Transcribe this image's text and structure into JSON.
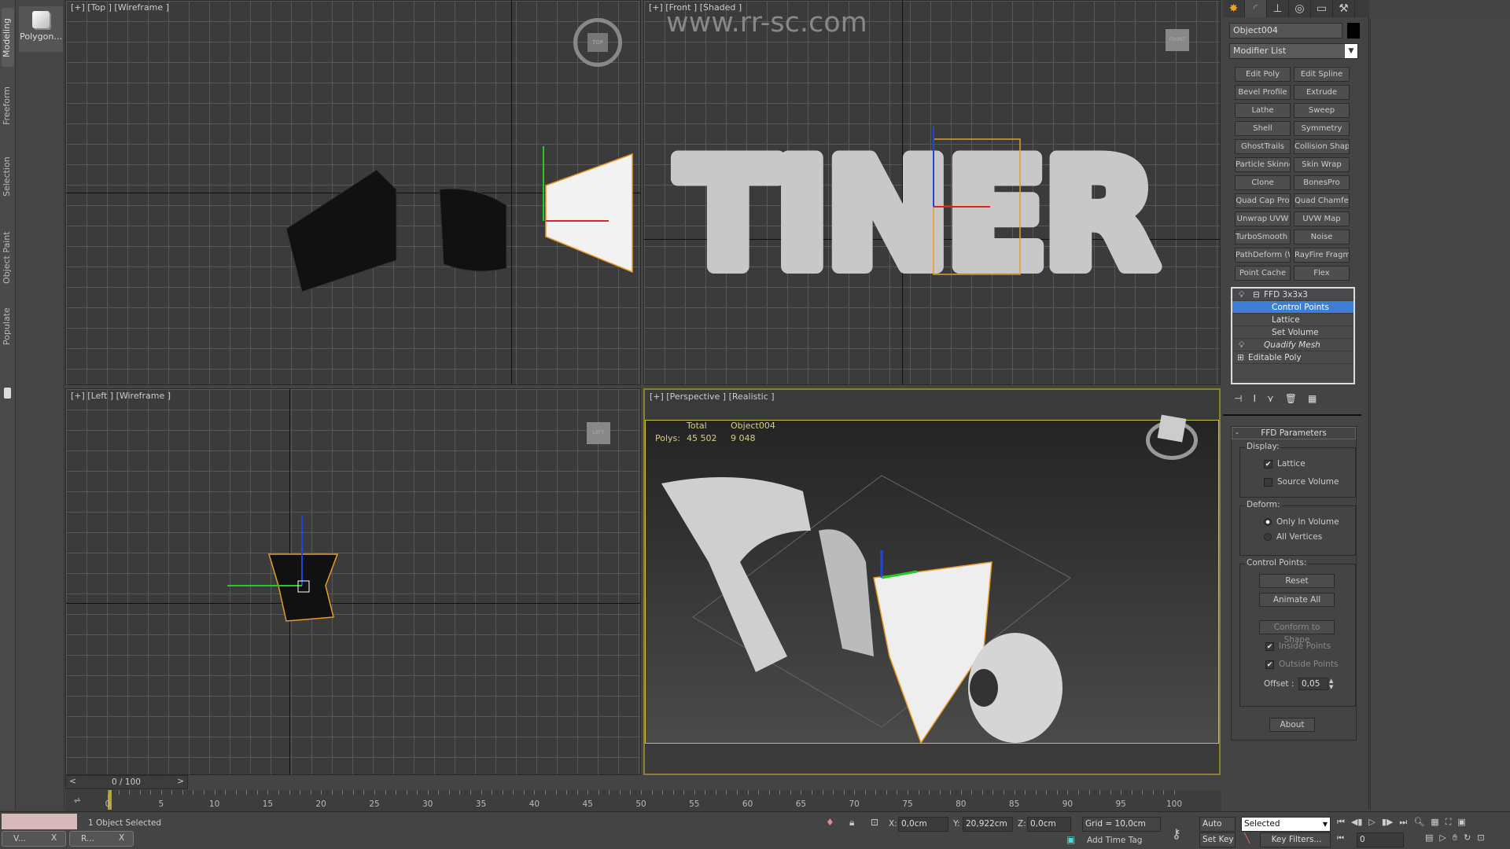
{
  "ribbon": {
    "tabs": [
      "Modeling",
      "Freeform",
      "Selection",
      "Object Paint",
      "Populate"
    ],
    "active_tab": "Modeling",
    "panel_button": "Polygon..."
  },
  "viewports": {
    "top": {
      "label": "[+] [Top ] [Wireframe ]",
      "gizmo": "TOP"
    },
    "front": {
      "label": "[+] [Front ] [Shaded ]",
      "gizmo": "FRONT",
      "scene_text": "TINER"
    },
    "left": {
      "label": "[+] [Left ] [Wireframe ]",
      "gizmo": "LEFT"
    },
    "perspective": {
      "label": "[+] [Perspective ] [Realistic ]",
      "stats": {
        "col_total": "Total",
        "col_object": "Object004",
        "row_label": "Polys:",
        "total": "45 502",
        "object": "9 048"
      }
    }
  },
  "watermark": "www.rr-sc.com",
  "command_panel": {
    "tabs": [
      "create-icon",
      "modify-icon",
      "hierarchy-icon",
      "motion-icon",
      "display-icon",
      "utilities-icon"
    ],
    "active_tab": "modify-icon",
    "object_name": "Object004",
    "object_color": "#000000",
    "modifier_list": "Modifier List",
    "modifier_buttons": [
      [
        "Edit Poly",
        "Edit Spline"
      ],
      [
        "Bevel Profile",
        "Extrude"
      ],
      [
        "Lathe",
        "Sweep"
      ],
      [
        "Shell",
        "Symmetry"
      ],
      [
        "GhostTrails",
        "Collision Shape"
      ],
      [
        "Particle Skinner",
        "Skin Wrap"
      ],
      [
        "Clone",
        "BonesPro"
      ],
      [
        "Quad Cap Pro",
        "Quad Chamfer"
      ],
      [
        "Unwrap UVW",
        "UVW Map"
      ],
      [
        "TurboSmooth Pr",
        "Noise"
      ],
      [
        "PathDeform (WS",
        "RayFire Fragmen"
      ],
      [
        "Point Cache",
        "Flex"
      ]
    ],
    "stack": {
      "ffd": "FFD 3x3x3",
      "sub": [
        "Control Points",
        "Lattice",
        "Set Volume"
      ],
      "selected": "Control Points",
      "quadify": "Quadify Mesh",
      "editable_poly": "Editable Poly"
    },
    "rollout": {
      "title": "FFD Parameters",
      "display_label": "Display:",
      "lattice": {
        "label": "Lattice",
        "checked": true
      },
      "source_volume": {
        "label": "Source Volume",
        "checked": false
      },
      "deform_label": "Deform:",
      "only_in_volume": {
        "label": "Only In Volume",
        "selected": true
      },
      "all_vertices": {
        "label": "All Vertices",
        "selected": false
      },
      "control_points_label": "Control Points:",
      "reset": "Reset",
      "animate_all": "Animate All",
      "conform": "Conform to Shape",
      "inside_points": {
        "label": "Inside Points",
        "checked": true
      },
      "outside_points": {
        "label": "Outside Points",
        "checked": true
      },
      "offset_label": "Offset :",
      "offset_value": "0,05",
      "about": "About"
    }
  },
  "timeline": {
    "frame": "0 / 100",
    "ticks": [
      "0",
      "5",
      "10",
      "15",
      "20",
      "25",
      "30",
      "35",
      "40",
      "45",
      "50",
      "55",
      "60",
      "65",
      "70",
      "75",
      "80",
      "85",
      "90",
      "95",
      "100"
    ]
  },
  "status": {
    "selection": "1 Object Selected",
    "x_label": "X:",
    "x": "0,0cm",
    "y_label": "Y:",
    "y": "20,922cm",
    "z_label": "Z:",
    "z": "0,0cm",
    "grid": "Grid = 10,0cm",
    "add_time_tag": "Add Time Tag",
    "auto_key": "Auto Key",
    "set_key": "Set Key",
    "key_mode": "Selected",
    "key_filters": "Key Filters...",
    "current_frame": "0",
    "taskbar": [
      "V...",
      "R..."
    ],
    "close": "X"
  }
}
